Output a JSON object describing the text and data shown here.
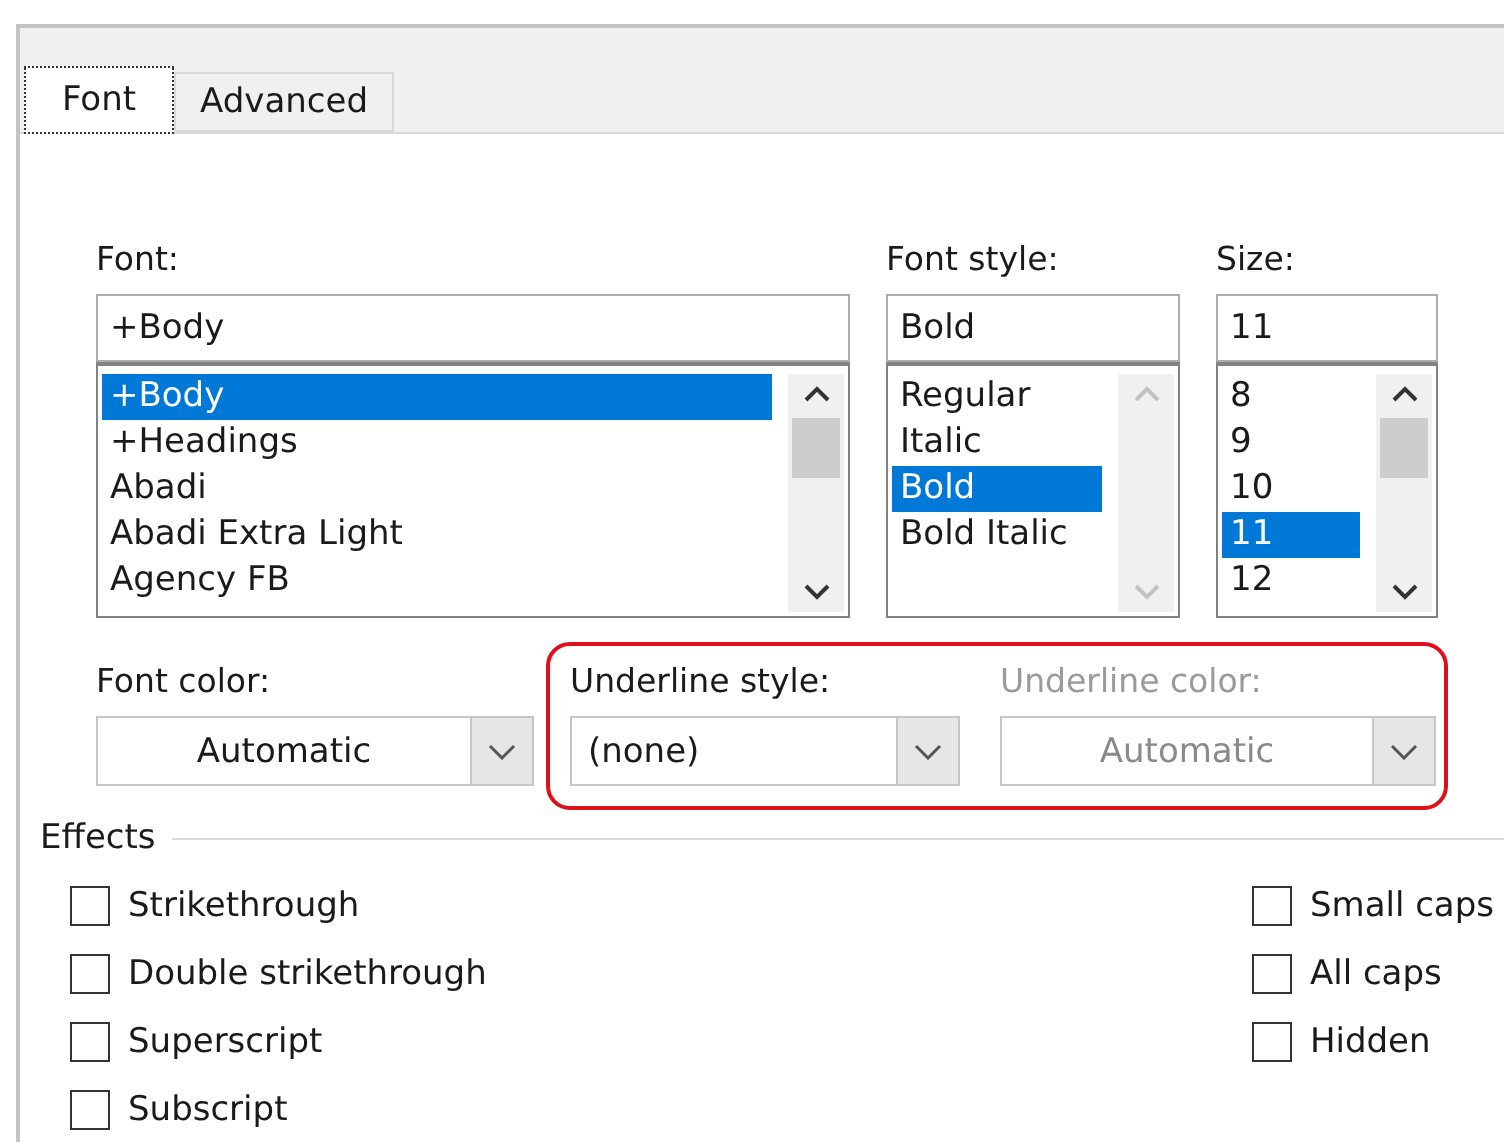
{
  "tabs": [
    {
      "label": "Font",
      "selected": true
    },
    {
      "label": "Advanced",
      "selected": false
    }
  ],
  "lists": [
    {
      "label": "Font:",
      "value": "+Body",
      "scrollbar_disabled": false,
      "items": [
        {
          "label": "+Body",
          "selected": true
        },
        {
          "label": "+Headings",
          "selected": false
        },
        {
          "label": "Abadi",
          "selected": false
        },
        {
          "label": "Abadi Extra Light",
          "selected": false
        },
        {
          "label": "Agency FB",
          "selected": false
        }
      ]
    },
    {
      "label": "Font style:",
      "value": "Bold",
      "scrollbar_disabled": true,
      "items": [
        {
          "label": "Regular",
          "selected": false
        },
        {
          "label": "Italic",
          "selected": false
        },
        {
          "label": "Bold",
          "selected": true
        },
        {
          "label": "Bold Italic",
          "selected": false
        }
      ]
    },
    {
      "label": "Size:",
      "value": "11",
      "scrollbar_disabled": false,
      "items": [
        {
          "label": "8",
          "selected": false
        },
        {
          "label": "9",
          "selected": false
        },
        {
          "label": "10",
          "selected": false
        },
        {
          "label": "11",
          "selected": true
        },
        {
          "label": "12",
          "selected": false
        }
      ]
    }
  ],
  "dropdowns": [
    {
      "label": "Font color:",
      "value": "Automatic",
      "kind": "color",
      "disabled": false,
      "highlighted": false
    },
    {
      "label": "Underline style:",
      "value": "(none)",
      "kind": "style",
      "disabled": false,
      "highlighted": true
    },
    {
      "label": "Underline color:",
      "value": "Automatic",
      "kind": "color",
      "disabled": true,
      "highlighted": true
    }
  ],
  "effects": {
    "title": "Effects",
    "left": [
      {
        "label": "Strikethrough",
        "checked": false
      },
      {
        "label": "Double strikethrough",
        "checked": false
      },
      {
        "label": "Superscript",
        "checked": false
      },
      {
        "label": "Subscript",
        "checked": false
      }
    ],
    "right": [
      {
        "label": "Small caps",
        "checked": false
      },
      {
        "label": "All caps",
        "checked": false
      },
      {
        "label": "Hidden",
        "checked": false
      }
    ]
  }
}
